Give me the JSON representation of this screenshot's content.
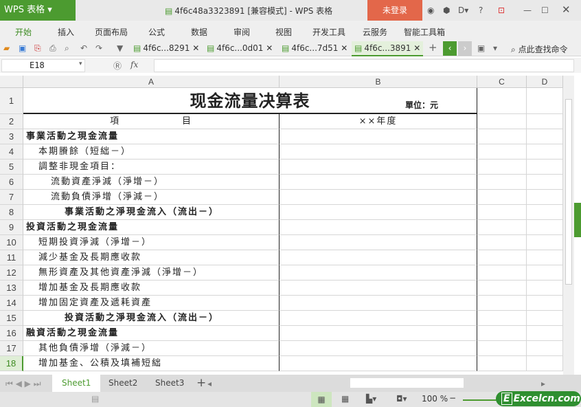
{
  "app": {
    "logo": "WPS 表格",
    "title": "4f6c48a3323891 [兼容模式] - WPS 表格",
    "login": "未登录",
    "help": "?"
  },
  "menu": [
    "开始",
    "插入",
    "页面布局",
    "公式",
    "数据",
    "审阅",
    "视图",
    "开发工具",
    "云服务",
    "智能工具箱"
  ],
  "doc_tabs": [
    "4f6c...8291",
    "4f6c...0d01",
    "4f6c...7d51",
    "4f6c...3891"
  ],
  "search_cmd": "点此查找命令",
  "formula": {
    "cell_ref": "E18",
    "fx": "fx",
    "value": ""
  },
  "columns": [
    "A",
    "B",
    "C",
    "D"
  ],
  "sheet": {
    "title": "现金流量决算表",
    "unit": "單位：元",
    "header_item": "項　　　　　　目",
    "header_year": "××年度",
    "rows": [
      {
        "n": "3",
        "text": "事業活動之現金流量",
        "indent": 0,
        "bold": true
      },
      {
        "n": "4",
        "text": "本期賸餘（短絀－）",
        "indent": 1,
        "bold": false
      },
      {
        "n": "5",
        "text": "調整非現金項目：",
        "indent": 1,
        "bold": false
      },
      {
        "n": "6",
        "text": "流動資產淨減（淨增－）",
        "indent": 2,
        "bold": false
      },
      {
        "n": "7",
        "text": "流動負債淨增（淨減－）",
        "indent": 2,
        "bold": false
      },
      {
        "n": "8",
        "text": "事業活動之淨現金流入（流出－）",
        "indent": 3,
        "bold": true
      },
      {
        "n": "9",
        "text": "投資活動之現金流量",
        "indent": 0,
        "bold": true
      },
      {
        "n": "10",
        "text": "短期投資淨減（淨增－）",
        "indent": 1,
        "bold": false
      },
      {
        "n": "11",
        "text": "減少基金及長期應收款",
        "indent": 1,
        "bold": false
      },
      {
        "n": "12",
        "text": "無形資產及其他資產淨減（淨增－）",
        "indent": 1,
        "bold": false
      },
      {
        "n": "13",
        "text": "增加基金及長期應收款",
        "indent": 1,
        "bold": false
      },
      {
        "n": "14",
        "text": "增加固定資產及遞耗資產",
        "indent": 1,
        "bold": false
      },
      {
        "n": "15",
        "text": "投資活動之淨現金流入（流出－）",
        "indent": 3,
        "bold": true
      },
      {
        "n": "16",
        "text": "融資活動之現金流量",
        "indent": 0,
        "bold": true
      },
      {
        "n": "17",
        "text": "其他負債淨增（淨減－）",
        "indent": 1,
        "bold": false
      },
      {
        "n": "18",
        "text": "增加基金、公積及填補短絀",
        "indent": 1,
        "bold": false
      }
    ]
  },
  "row_labels": {
    "r1": "1",
    "r2": "2"
  },
  "sheet_tabs": [
    "Sheet1",
    "Sheet2",
    "Sheet3"
  ],
  "status": {
    "zoom": "100 %",
    "brand": "Excelcn.com"
  }
}
